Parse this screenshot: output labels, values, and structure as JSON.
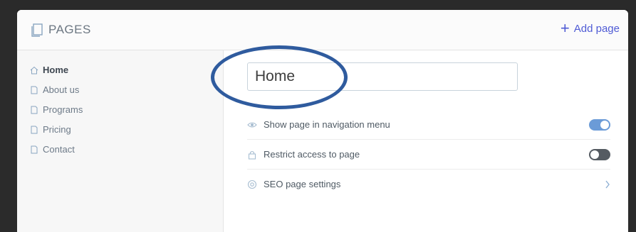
{
  "header": {
    "title": "PAGES",
    "add_page_label": "Add page",
    "add_page_icon": "plus-icon"
  },
  "sidebar": {
    "items": [
      {
        "label": "Home",
        "icon": "home-icon",
        "active": true
      },
      {
        "label": "About us",
        "icon": "page-icon",
        "active": false
      },
      {
        "label": "Programs",
        "icon": "page-icon",
        "active": false
      },
      {
        "label": "Pricing",
        "icon": "page-icon",
        "active": false
      },
      {
        "label": "Contact",
        "icon": "page-icon",
        "active": false
      }
    ]
  },
  "main": {
    "page_name_value": "Home",
    "settings": [
      {
        "label": "Show page in navigation menu",
        "icon": "eye-icon",
        "control": "toggle",
        "state": "on"
      },
      {
        "label": "Restrict access to page",
        "icon": "lock-icon",
        "control": "toggle",
        "state": "off"
      },
      {
        "label": "SEO page settings",
        "icon": "seo-icon",
        "control": "chevron"
      }
    ]
  },
  "colors": {
    "accent": "#4f5bd5",
    "toggle_on": "#6b9bd7",
    "toggle_off": "#555b62",
    "annotation": "#2f5b9e"
  }
}
